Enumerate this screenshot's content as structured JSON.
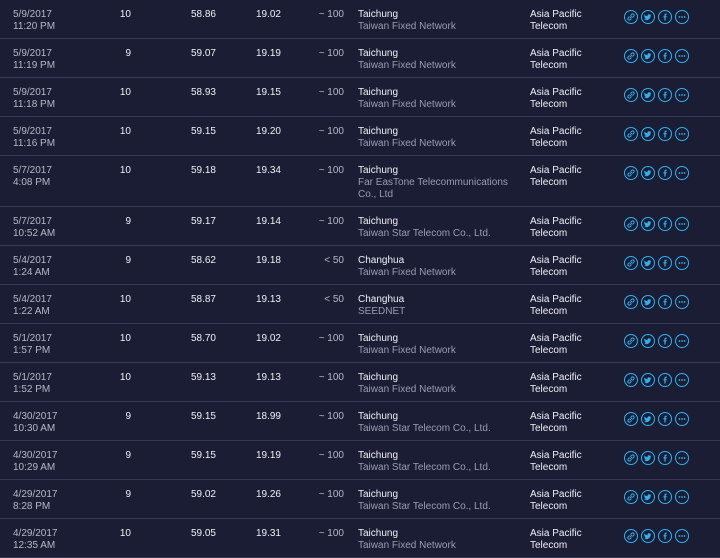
{
  "results": [
    {
      "date": "5/9/2017",
      "time": "11:20 PM",
      "connections": "10",
      "v1": "58.86",
      "v2": "19.02",
      "v3": "~ 100",
      "city": "Taichung",
      "isp": "Taiwan Fixed Network",
      "server_line1": "Asia Pacific",
      "server_line2": "Telecom"
    },
    {
      "date": "5/9/2017",
      "time": "11:19 PM",
      "connections": "9",
      "v1": "59.07",
      "v2": "19.19",
      "v3": "~ 100",
      "city": "Taichung",
      "isp": "Taiwan Fixed Network",
      "server_line1": "Asia Pacific",
      "server_line2": "Telecom"
    },
    {
      "date": "5/9/2017",
      "time": "11:18 PM",
      "connections": "10",
      "v1": "58.93",
      "v2": "19.15",
      "v3": "~ 100",
      "city": "Taichung",
      "isp": "Taiwan Fixed Network",
      "server_line1": "Asia Pacific",
      "server_line2": "Telecom"
    },
    {
      "date": "5/9/2017",
      "time": "11:16 PM",
      "connections": "10",
      "v1": "59.15",
      "v2": "19.20",
      "v3": "~ 100",
      "city": "Taichung",
      "isp": "Taiwan Fixed Network",
      "server_line1": "Asia Pacific",
      "server_line2": "Telecom"
    },
    {
      "date": "5/7/2017",
      "time": "4:08 PM",
      "connections": "10",
      "v1": "59.18",
      "v2": "19.34",
      "v3": "~ 100",
      "city": "Taichung",
      "isp": "Far EasTone Telecommunications Co., Ltd",
      "server_line1": "Asia Pacific",
      "server_line2": "Telecom"
    },
    {
      "date": "5/7/2017",
      "time": "10:52 AM",
      "connections": "9",
      "v1": "59.17",
      "v2": "19.14",
      "v3": "~ 100",
      "city": "Taichung",
      "isp": "Taiwan Star Telecom Co., Ltd.",
      "server_line1": "Asia Pacific",
      "server_line2": "Telecom"
    },
    {
      "date": "5/4/2017",
      "time": "1:24 AM",
      "connections": "9",
      "v1": "58.62",
      "v2": "19.18",
      "v3": "< 50",
      "city": "Changhua",
      "isp": "Taiwan Fixed Network",
      "server_line1": "Asia Pacific",
      "server_line2": "Telecom"
    },
    {
      "date": "5/4/2017",
      "time": "1:22 AM",
      "connections": "10",
      "v1": "58.87",
      "v2": "19.13",
      "v3": "< 50",
      "city": "Changhua",
      "isp": "SEEDNET",
      "server_line1": "Asia Pacific",
      "server_line2": "Telecom"
    },
    {
      "date": "5/1/2017",
      "time": "1:57 PM",
      "connections": "10",
      "v1": "58.70",
      "v2": "19.02",
      "v3": "~ 100",
      "city": "Taichung",
      "isp": "Taiwan Fixed Network",
      "server_line1": "Asia Pacific",
      "server_line2": "Telecom"
    },
    {
      "date": "5/1/2017",
      "time": "1:52 PM",
      "connections": "10",
      "v1": "59.13",
      "v2": "19.13",
      "v3": "~ 100",
      "city": "Taichung",
      "isp": "Taiwan Fixed Network",
      "server_line1": "Asia Pacific",
      "server_line2": "Telecom"
    },
    {
      "date": "4/30/2017",
      "time": "10:30 AM",
      "connections": "9",
      "v1": "59.15",
      "v2": "18.99",
      "v3": "~ 100",
      "city": "Taichung",
      "isp": "Taiwan Star Telecom Co., Ltd.",
      "server_line1": "Asia Pacific",
      "server_line2": "Telecom"
    },
    {
      "date": "4/30/2017",
      "time": "10:29 AM",
      "connections": "9",
      "v1": "59.15",
      "v2": "19.19",
      "v3": "~ 100",
      "city": "Taichung",
      "isp": "Taiwan Star Telecom Co., Ltd.",
      "server_line1": "Asia Pacific",
      "server_line2": "Telecom"
    },
    {
      "date": "4/29/2017",
      "time": "8:28 PM",
      "connections": "9",
      "v1": "59.02",
      "v2": "19.26",
      "v3": "~ 100",
      "city": "Taichung",
      "isp": "Taiwan Star Telecom Co., Ltd.",
      "server_line1": "Asia Pacific",
      "server_line2": "Telecom"
    },
    {
      "date": "4/29/2017",
      "time": "12:35 AM",
      "connections": "10",
      "v1": "59.05",
      "v2": "19.31",
      "v3": "~ 100",
      "city": "Taichung",
      "isp": "Taiwan Fixed Network",
      "server_line1": "Asia Pacific",
      "server_line2": "Telecom"
    }
  ],
  "row_actions": [
    {
      "icon": "link-icon"
    },
    {
      "icon": "twitter-icon"
    },
    {
      "icon": "facebook-icon"
    },
    {
      "icon": "more-options-icon"
    }
  ],
  "colors": {
    "background": "#1b1d35",
    "divider": "#363a57",
    "accent": "#2fb1f0",
    "text_primary": "#f0f0f5",
    "text_secondary": "#9a9cb0"
  }
}
